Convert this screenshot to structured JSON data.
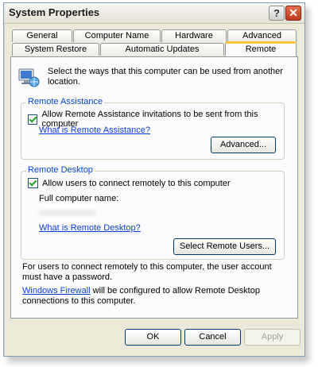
{
  "window": {
    "title": "System Properties"
  },
  "tabs": {
    "row1": [
      "General",
      "Computer Name",
      "Hardware",
      "Advanced"
    ],
    "row2": [
      "System Restore",
      "Automatic Updates",
      "Remote"
    ]
  },
  "intro": "Select the ways that this computer can be used from another location.",
  "remote_assistance": {
    "label": "Remote Assistance",
    "checkbox_label": "Allow Remote Assistance invitations to be sent from this computer",
    "checked": true,
    "help_link": "What is Remote Assistance?",
    "advanced_button": "Advanced..."
  },
  "remote_desktop": {
    "label": "Remote Desktop",
    "checkbox_label": "Allow users to connect remotely to this computer",
    "checked": true,
    "full_name_label": "Full computer name:",
    "help_link": "What is Remote Desktop?",
    "select_users_button": "Select Remote Users..."
  },
  "notes": {
    "password_note": "For users to connect remotely to this computer, the user account must have a password.",
    "firewall_link": "Windows Firewall",
    "firewall_text": " will be configured to allow Remote Desktop connections to this computer."
  },
  "buttons": {
    "ok": "OK",
    "cancel": "Cancel",
    "apply": "Apply"
  },
  "icons": {
    "help": "help-icon",
    "close": "close-icon",
    "intro": "remote-computer-icon"
  }
}
